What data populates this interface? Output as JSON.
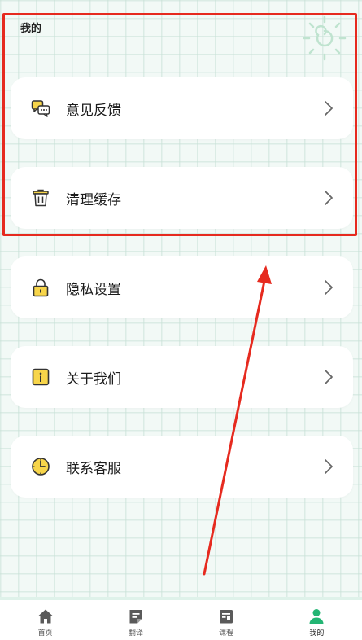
{
  "header": {
    "title": "我的"
  },
  "menu": {
    "items": [
      {
        "label": "意见反馈",
        "icon": "feedback-chat-icon"
      },
      {
        "label": "清理缓存",
        "icon": "trash-can-icon"
      },
      {
        "label": "隐私设置",
        "icon": "lock-icon"
      },
      {
        "label": "关于我们",
        "icon": "info-icon"
      },
      {
        "label": "联系客服",
        "icon": "clock-icon"
      }
    ]
  },
  "tabbar": {
    "tabs": [
      {
        "label": "首页",
        "icon": "home-icon",
        "active": false
      },
      {
        "label": "翻译",
        "icon": "translate-icon",
        "active": false
      },
      {
        "label": "课程",
        "icon": "course-icon",
        "active": false
      },
      {
        "label": "我的",
        "icon": "user-icon",
        "active": true
      }
    ]
  },
  "colors": {
    "background": "#f2f9f6",
    "accent_green": "#22b573",
    "icon_yellow": "#f7d54a",
    "annotation_red": "#e62a1f"
  }
}
